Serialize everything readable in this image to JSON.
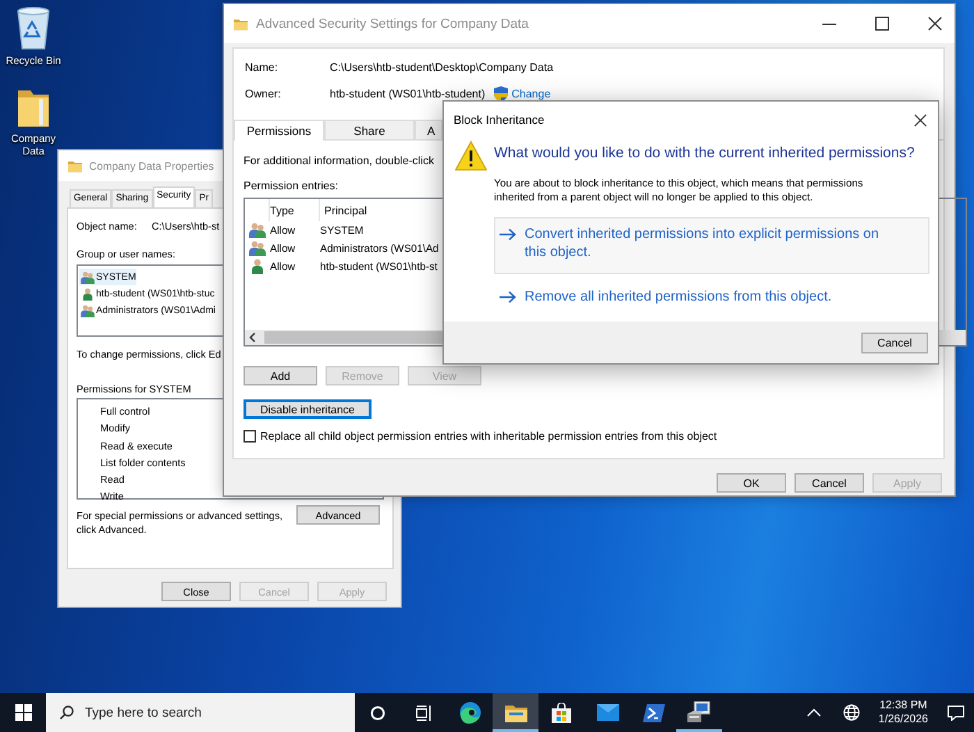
{
  "desktop_icons": [
    {
      "kind": "recycle-bin",
      "label": "Recycle Bin"
    },
    {
      "kind": "folder",
      "label": "Company Data"
    }
  ],
  "properties_window": {
    "title": "Company Data Properties",
    "tabs": [
      {
        "label": "General",
        "selected": false
      },
      {
        "label": "Sharing",
        "selected": false
      },
      {
        "label": "Security",
        "selected": true
      },
      {
        "label": "Pr",
        "selected": false
      }
    ],
    "object_name_label": "Object name:",
    "object_name": "C:\\Users\\htb-st",
    "group_label": "Group or user names:",
    "principals": [
      {
        "kind": "group",
        "name": "SYSTEM",
        "selected": true
      },
      {
        "kind": "user",
        "name": "htb-student (WS01\\htb-stuc",
        "selected": false
      },
      {
        "kind": "group",
        "name": "Administrators (WS01\\Admi",
        "selected": false
      }
    ],
    "change_hint": "To change permissions, click Ed",
    "permissions_label": "Permissions for SYSTEM",
    "permissions": [
      "Full control",
      "Modify",
      "Read & execute",
      "List folder contents",
      "Read",
      "Write"
    ],
    "advanced_hint": "For special permissions or advanced settings, click Advanced.",
    "advanced_button": "Advanced",
    "buttons": [
      {
        "label": "Close",
        "disabled": false
      },
      {
        "label": "Cancel",
        "disabled": true
      },
      {
        "label": "Apply",
        "disabled": true
      }
    ]
  },
  "advanced_window": {
    "title": "Advanced Security Settings for Company Data",
    "name_label": "Name:",
    "name": "C:\\Users\\htb-student\\Desktop\\Company Data",
    "owner_label": "Owner:",
    "owner": "htb-student (WS01\\htb-student)",
    "change_link": "Change",
    "tabs": [
      {
        "label": "Permissions",
        "selected": true
      },
      {
        "label": "Share",
        "selected": false
      },
      {
        "label": "A",
        "selected": false
      }
    ],
    "info": "For additional information, double-click",
    "entries_label": "Permission entries:",
    "columns": [
      "Type",
      "Principal"
    ],
    "entries": [
      {
        "kind": "group",
        "type": "Allow",
        "principal": "SYSTEM"
      },
      {
        "kind": "group",
        "type": "Allow",
        "principal": "Administrators (WS01\\Ad"
      },
      {
        "kind": "user",
        "type": "Allow",
        "principal": "htb-student (WS01\\htb-st"
      }
    ],
    "entry_buttons": [
      {
        "label": "Add",
        "disabled": false
      },
      {
        "label": "Remove",
        "disabled": true
      },
      {
        "label": "View",
        "disabled": true
      }
    ],
    "disable_inheritance": "Disable inheritance",
    "replace_checkbox": {
      "label": "Replace all child object permission entries with inheritable permission entries from this object",
      "checked": false
    },
    "buttons": [
      {
        "label": "OK",
        "disabled": false
      },
      {
        "label": "Cancel",
        "disabled": false
      },
      {
        "label": "Apply",
        "disabled": true
      }
    ]
  },
  "block_dialog": {
    "title": "Block Inheritance",
    "heading": "What would you like to do with the current inherited permissions?",
    "description": "You are about to block inheritance to this object, which means that permissions inherited from a parent object will no longer be applied to this object.",
    "options": [
      {
        "label": "Convert inherited permissions into explicit permissions on this object.",
        "highlighted": true
      },
      {
        "label": "Remove all inherited permissions from this object.",
        "highlighted": false
      }
    ],
    "cancel": "Cancel"
  },
  "taskbar": {
    "search_placeholder": "Type here to search",
    "apps": [
      {
        "kind": "cortana",
        "running": false,
        "active": false
      },
      {
        "kind": "task-view",
        "running": false,
        "active": false
      },
      {
        "kind": "edge",
        "running": false,
        "active": false
      },
      {
        "kind": "explorer",
        "running": true,
        "active": true
      },
      {
        "kind": "store",
        "running": false,
        "active": false
      },
      {
        "kind": "mail",
        "running": false,
        "active": false
      },
      {
        "kind": "powershell",
        "running": false,
        "active": false
      },
      {
        "kind": "server-manager",
        "running": true,
        "active": false
      }
    ],
    "time": "12:38 PM",
    "date": "1/26/2026"
  }
}
